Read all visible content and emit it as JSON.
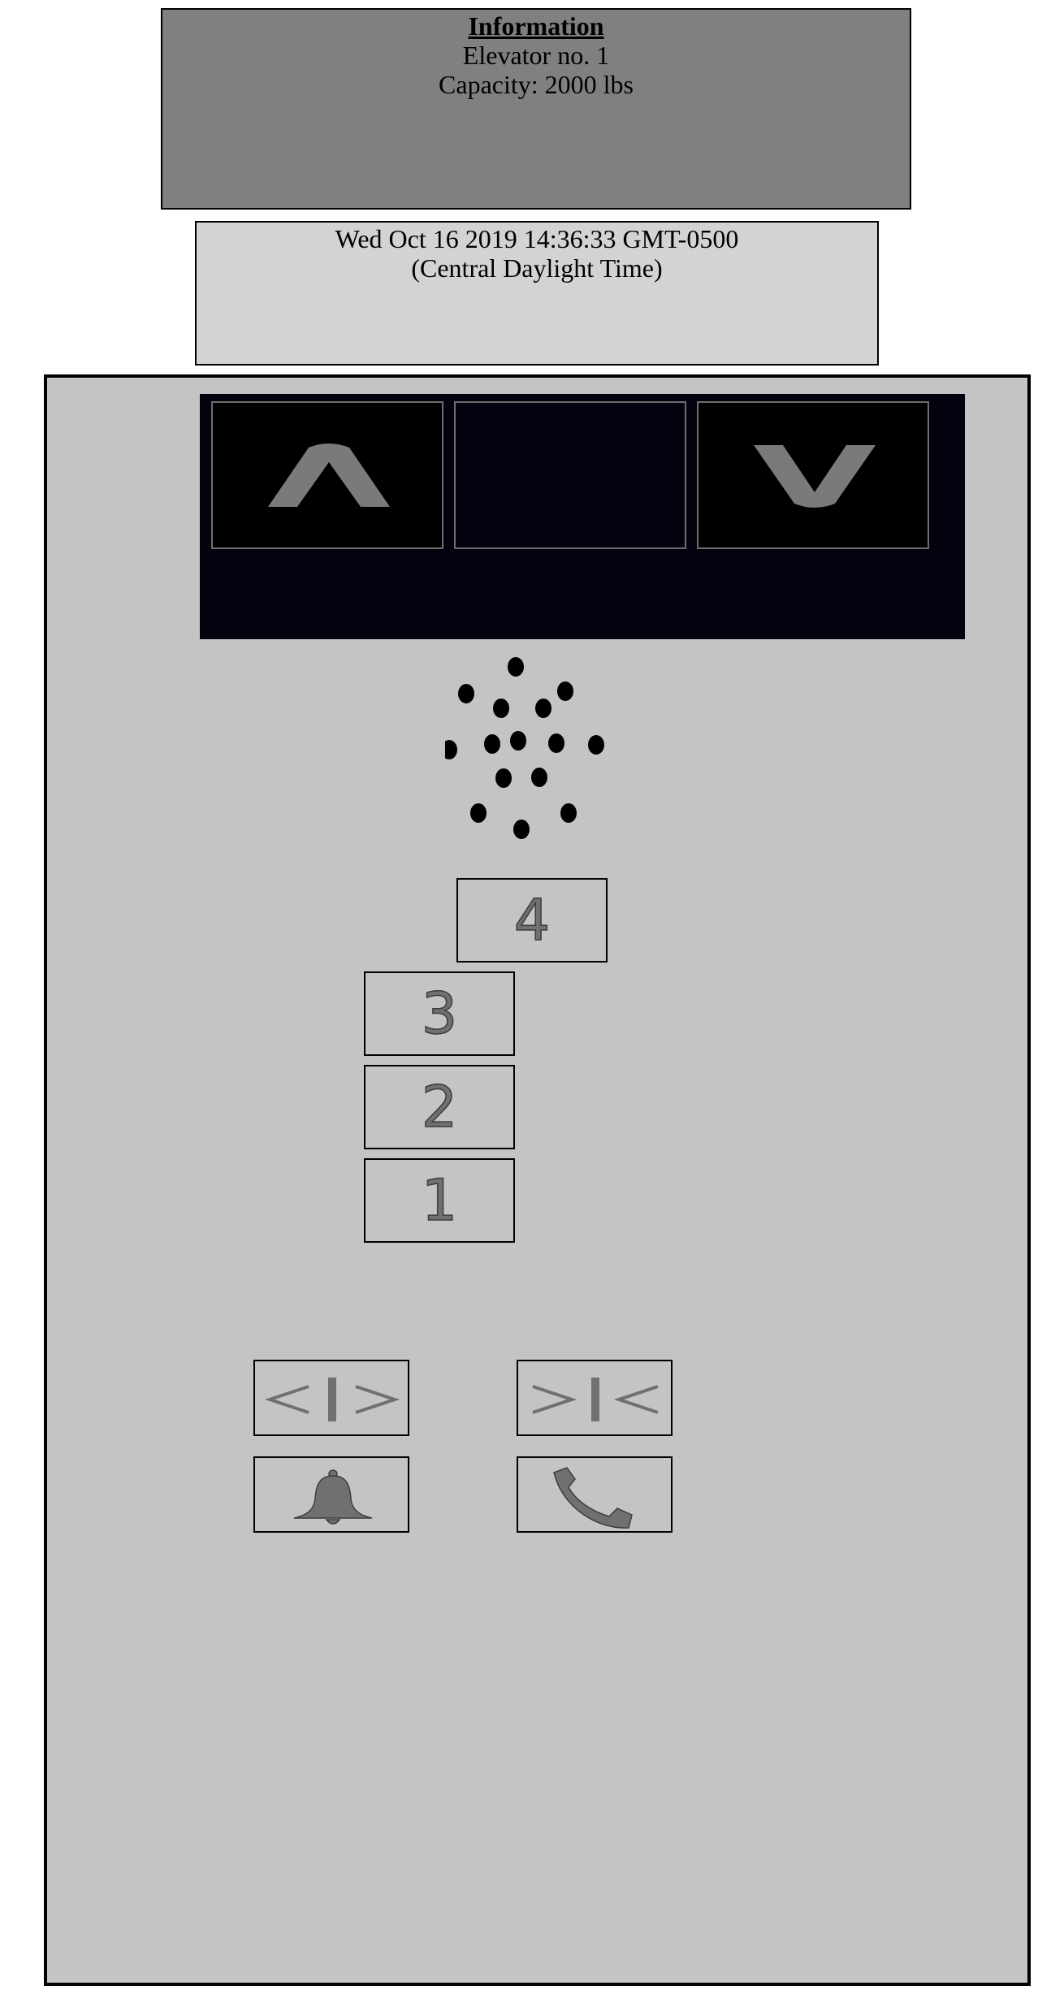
{
  "info": {
    "title": "Information",
    "elevator": "Elevator no. 1",
    "capacity": "Capacity: 2000 lbs"
  },
  "datetime": {
    "line1": "Wed Oct 16 2019 14:36:33 GMT-0500",
    "line2": "(Central Daylight Time)"
  },
  "indicator": {
    "up_icon": "chevron-up-icon",
    "down_icon": "chevron-down-icon",
    "current_floor": ""
  },
  "floor_buttons": {
    "f4": "4",
    "f3": "3",
    "f2": "2",
    "f1": "1"
  },
  "controls": {
    "door_open_icon": "door-open-icon",
    "door_close_icon": "door-close-icon",
    "alarm_icon": "bell-icon",
    "phone_icon": "phone-icon"
  },
  "colors": {
    "info_bg": "#808080",
    "date_bg": "#d3d3d3",
    "panel_bg": "#c3c4c3",
    "indicator_bg": "#02030f",
    "icon_gray": "#707070"
  }
}
